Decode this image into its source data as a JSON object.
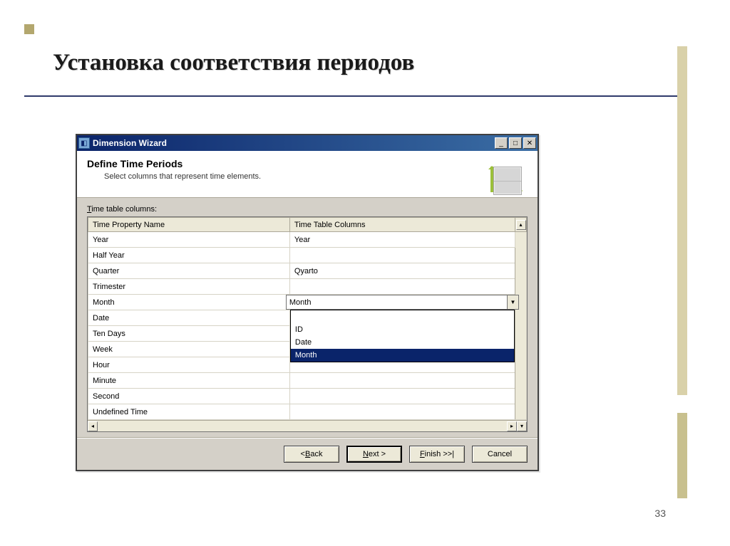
{
  "slide": {
    "title": "Установка соответствия периодов",
    "page": "33"
  },
  "window": {
    "title": "Dimension Wizard",
    "header_title": "Define Time Periods",
    "header_sub": "Select columns that represent time elements.",
    "table_label_pre": "T",
    "table_label_rest": "ime table columns:",
    "columns": {
      "c0": "Time Property Name",
      "c1": "Time Table Columns"
    },
    "rows": [
      {
        "name": "Year",
        "col": "Year"
      },
      {
        "name": "Half Year",
        "col": ""
      },
      {
        "name": "Quarter",
        "col": "Qyarto"
      },
      {
        "name": "Trimester",
        "col": ""
      },
      {
        "name": "Month",
        "col": "Month",
        "combo": true
      },
      {
        "name": "Date",
        "col": ""
      },
      {
        "name": "Ten Days",
        "col": ""
      },
      {
        "name": "Week",
        "col": ""
      },
      {
        "name": "Hour",
        "col": ""
      },
      {
        "name": "Minute",
        "col": ""
      },
      {
        "name": "Second",
        "col": ""
      },
      {
        "name": "Undefined Time",
        "col": ""
      }
    ],
    "dropdown": {
      "options": [
        "",
        "ID",
        "Date",
        "Month"
      ],
      "selected": "Month"
    },
    "buttons": {
      "back_pre": "< ",
      "back_u": "B",
      "back_rest": "ack",
      "next_u": "N",
      "next_rest": "ext >",
      "finish_u": "F",
      "finish_rest": "inish >>|",
      "cancel": "Cancel"
    }
  }
}
